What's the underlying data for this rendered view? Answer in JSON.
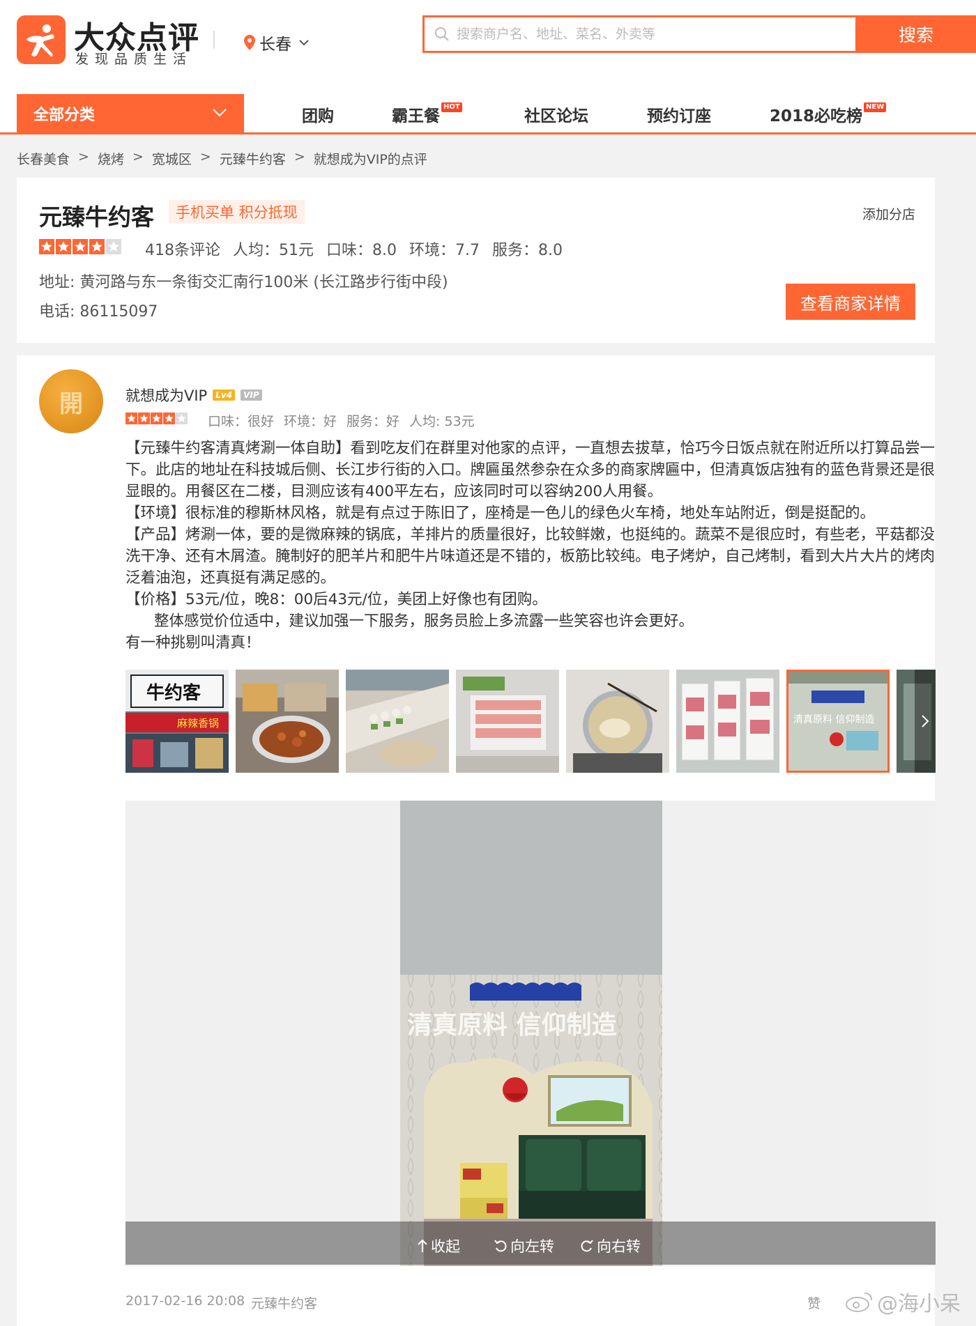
{
  "brand": {
    "name": "大众点评",
    "slogan": "发现品质生活",
    "color": "#ff6633"
  },
  "city": {
    "name": "长春"
  },
  "search": {
    "placeholder": "搜索商户名、地址、菜名、外卖等",
    "button": "搜索"
  },
  "nav": {
    "all": "全部分类",
    "items": [
      {
        "label": "团购",
        "tag": ""
      },
      {
        "label": "霸王餐",
        "tag": "HOT"
      },
      {
        "label": "社区论坛",
        "tag": ""
      },
      {
        "label": "预约订座",
        "tag": ""
      },
      {
        "label": "2018必吃榜",
        "tag": "NEW"
      }
    ]
  },
  "breadcrumb": [
    "长春美食",
    "烧烤",
    "宽城区",
    "元臻牛约客",
    "就想成为VIP的点评"
  ],
  "breadcrumb_sep": ">",
  "shop": {
    "name": "元臻牛约客",
    "badge": "手机买单 积分抵现",
    "add_branch": "添加分店",
    "rating": 4,
    "reviews": "418条评论",
    "avg": "人均：51元",
    "taste": "口味：8.0",
    "env": "环境：7.7",
    "service": "服务：8.0",
    "address": "地址: 黄河路与东一条街交汇南行100米 (长江路步行街中段)",
    "phone": "电话: 86115097",
    "detail_button": "查看商家详情"
  },
  "review": {
    "avatar_char": "開",
    "user": "就想成为VIP",
    "level": "Lv4",
    "vip": "VIP",
    "rating": 4,
    "taste": "口味：很好",
    "env": "环境：好",
    "service": "服务：好",
    "avg": "人均: 53元",
    "paragraphs": [
      "【元臻牛约客清真烤涮一体自助】看到吃友们在群里对他家的点评，一直想去拔草，恰巧今日饭点就在附近所以打算品尝一下。此店的地址在科技城后侧、长江步行街的入口。牌匾虽然参杂在众多的商家牌匾中，但清真饭店独有的蓝色背景还是很显眼的。用餐区在二楼，目测应该有400平左右，应该同时可以容纳200人用餐。",
      "【环境】很标准的穆斯林风格，就是有点过于陈旧了，座椅是一色儿的绿色火车椅，地处车站附近，倒是挺配的。",
      "【产品】烤涮一体，要的是微麻辣的锅底，羊排片的质量很好，比较鲜嫩，也挺纯的。蔬菜不是很应时，有些老，平菇都没洗干净、还有木屑渣。腌制好的肥羊片和肥牛片味道还是不错的，板筋比较纯。电子烤炉，自己烤制，看到大片大片的烤肉泛着油泡，还真挺有满足感的。",
      "【价格】53元/位，晚8：00后43元/位，美团上好像也有团购。",
      "      整体感觉价位适中，建议加强一下服务，服务员脸上多流露一些笑容也许会更好。",
      "有一种挑剔叫清真！"
    ],
    "photo_signs": {
      "sign1": "牛约客",
      "sign2": "麻辣香锅",
      "wall_text": "清真原料  信仰制造"
    },
    "viewer": {
      "collapse": "收起",
      "rotate_left": "向左转",
      "rotate_right": "向右转"
    },
    "date": "2017-02-16 20:08",
    "shop": "元臻牛约客",
    "like": "赞",
    "watermark": "@海小呆"
  }
}
